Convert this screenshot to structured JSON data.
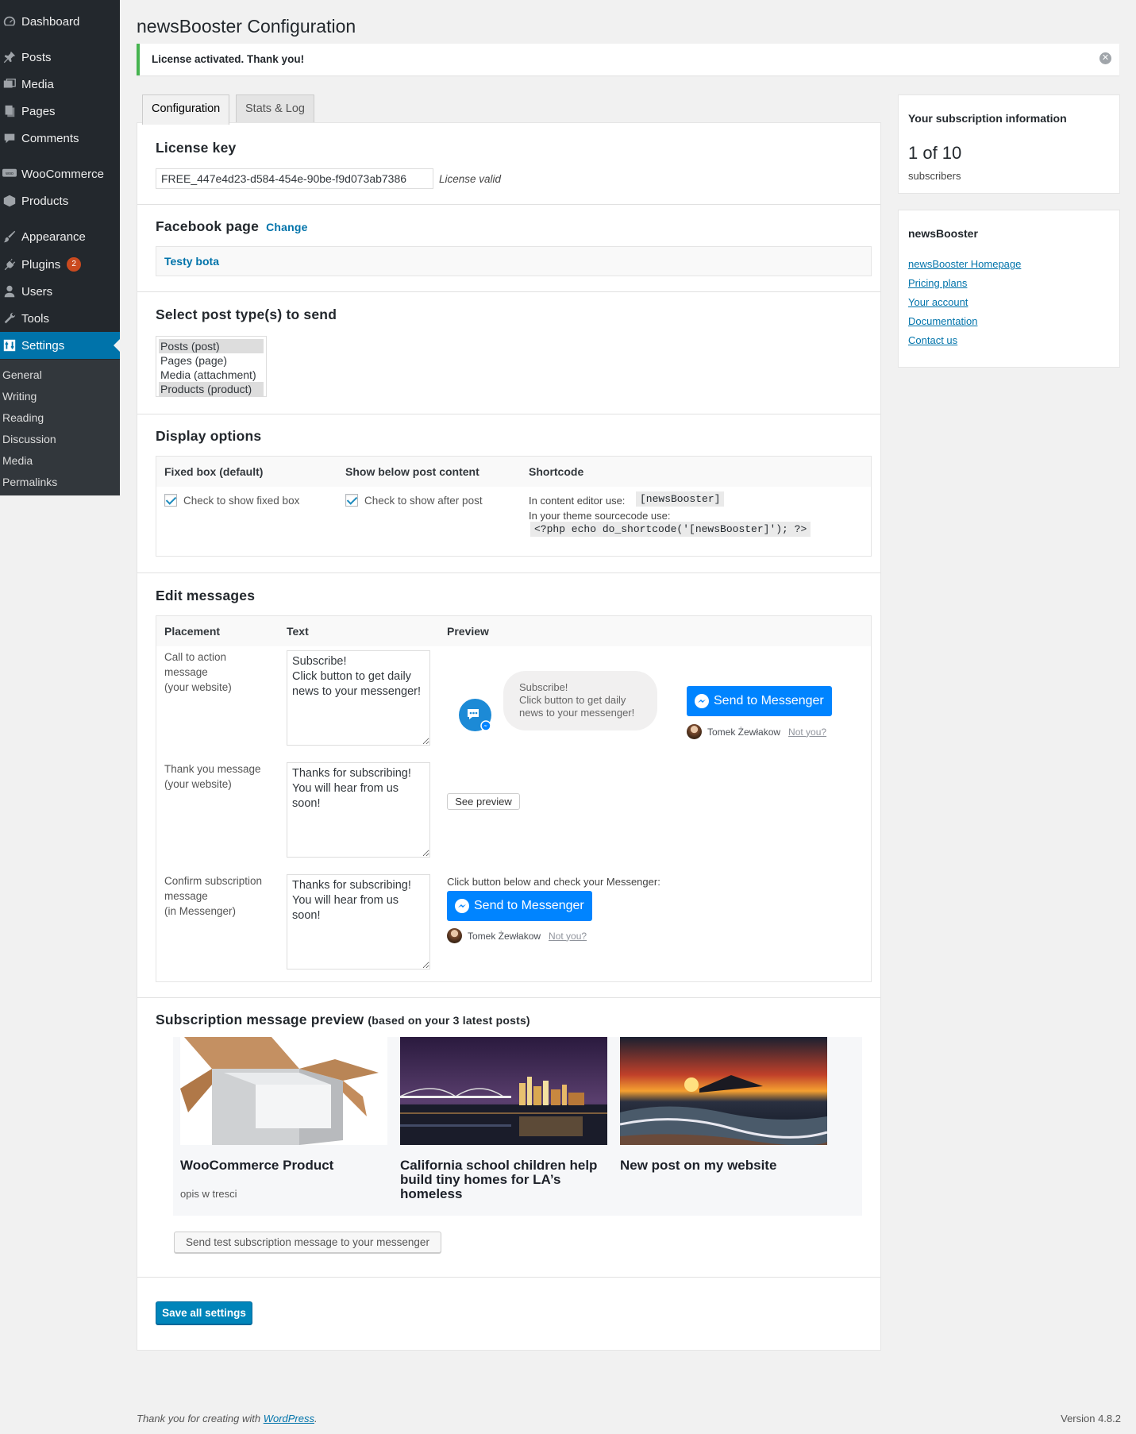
{
  "sidebar": {
    "items": [
      {
        "label": "Dashboard",
        "icon": "dashboard-icon"
      },
      {
        "label": "Posts",
        "icon": "pin-icon"
      },
      {
        "label": "Media",
        "icon": "media-icon"
      },
      {
        "label": "Pages",
        "icon": "pages-icon"
      },
      {
        "label": "Comments",
        "icon": "comment-icon"
      },
      {
        "label": "WooCommerce",
        "icon": "woocommerce-icon"
      },
      {
        "label": "Products",
        "icon": "box-icon"
      },
      {
        "label": "Appearance",
        "icon": "brush-icon"
      },
      {
        "label": "Plugins",
        "icon": "plug-icon",
        "badge": "2"
      },
      {
        "label": "Users",
        "icon": "user-icon"
      },
      {
        "label": "Tools",
        "icon": "wrench-icon"
      },
      {
        "label": "Settings",
        "icon": "settings-icon"
      }
    ],
    "submenu": [
      "General",
      "Writing",
      "Reading",
      "Discussion",
      "Media",
      "Permalinks"
    ]
  },
  "page": {
    "title": "newsBooster Configuration",
    "notice": "License activated. Thank you!",
    "dismiss": "✕"
  },
  "tabs": {
    "config": "Configuration",
    "stats": "Stats & Log"
  },
  "license": {
    "heading": "License key",
    "key": "FREE_447e4d23-d584-454e-90be-f9d073ab7386",
    "status": "License valid"
  },
  "facebook": {
    "heading": "Facebook page",
    "change": "Change",
    "page_name": "Testy bota"
  },
  "post_types": {
    "heading": "Select post type(s) to send",
    "options": [
      {
        "label": "Posts (post)",
        "selected": true
      },
      {
        "label": "Pages (page)",
        "selected": false
      },
      {
        "label": "Media (attachment)",
        "selected": false
      },
      {
        "label": "Products (product)",
        "selected": true
      }
    ]
  },
  "display": {
    "heading": "Display options",
    "col1": "Fixed box (default)",
    "col2": "Show below post content",
    "col3": "Shortcode",
    "cb1": "Check to show fixed box",
    "cb2": "Check to show after post",
    "editor_label": "In content editor use:",
    "editor_code": "[newsBooster]",
    "theme_label": "In your theme sourcecode use:",
    "theme_code": "<?php echo do_shortcode('[newsBooster]'); ?>"
  },
  "messages": {
    "heading": "Edit messages",
    "th_placement": "Placement",
    "th_text": "Text",
    "th_preview": "Preview",
    "rows": [
      {
        "placement": [
          "Call to action",
          "message",
          "(your website)"
        ],
        "text": "Subscribe!\nClick button to get daily news to your messenger!"
      },
      {
        "placement": [
          "Thank you message",
          "(your website)"
        ],
        "text": "Thanks for subscribing! You will hear from us soon!"
      },
      {
        "placement": [
          "Confirm subscription",
          "message",
          "(in Messenger)"
        ],
        "text": "Thanks for subscribing! You will hear from us soon!"
      }
    ],
    "bubble": [
      "Subscribe!",
      "Click button to get daily",
      "news to your messenger!"
    ],
    "send_btn": "Send to Messenger",
    "user": "Tomek Żewłakow",
    "not_you": "Not you?",
    "see_preview": "See preview",
    "confirm_instruction": "Click button below and check your Messenger:"
  },
  "preview": {
    "heading": "Subscription message preview",
    "subheading": "(based on your 3 latest posts)",
    "posts": [
      {
        "title": "WooCommerce Product",
        "sub": "opis w tresci"
      },
      {
        "title": "California school children help build tiny homes for LA’s homeless",
        "sub": ""
      },
      {
        "title": "New post on my website",
        "sub": ""
      }
    ],
    "test_btn": "Send test subscription message to your messenger"
  },
  "save_btn": "Save all settings",
  "subscription": {
    "heading": "Your subscription information",
    "count": "1 of 10",
    "label": "subscribers"
  },
  "nb_box": {
    "heading": "newsBooster",
    "links": [
      "newsBooster Homepage",
      "Pricing plans",
      "Your account",
      "Documentation",
      "Contact us"
    ]
  },
  "footer": {
    "left_text": "Thank you for creating with ",
    "left_link": "WordPress",
    "left_end": ".",
    "version": "Version 4.8.2"
  }
}
